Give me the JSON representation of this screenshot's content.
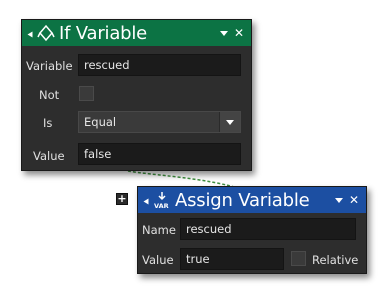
{
  "if_variable": {
    "title": "If Variable",
    "icon": "branch-icon",
    "variable_label": "Variable",
    "variable_value": "rescued",
    "not_label": "Not",
    "not_checked": false,
    "is_label": "Is",
    "is_value": "Equal",
    "value_label": "Value",
    "value_value": "false"
  },
  "assign_variable": {
    "title": "Assign Variable",
    "icon": "var-assign-icon",
    "name_label": "Name",
    "name_value": "rescued",
    "value_label": "Value",
    "value_value": "true",
    "relative_label": "Relative",
    "relative_checked": false
  },
  "add_button_label": "+",
  "colors": {
    "if_header": "#0c7344",
    "assign_header": "#1c4fa2",
    "panel_bg": "#2d2d2d",
    "connector": "#4caf50"
  }
}
